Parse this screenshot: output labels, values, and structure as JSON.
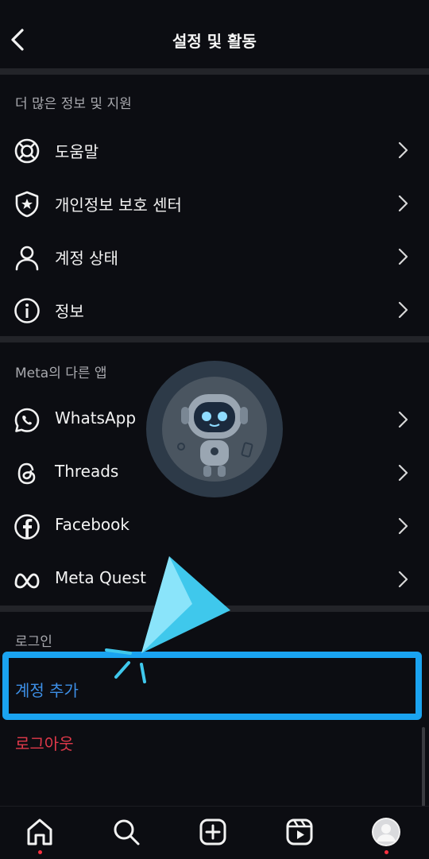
{
  "header": {
    "title": "설정 및 활동"
  },
  "sections": {
    "more_info": {
      "label": "더 많은 정보 및 지원",
      "items": [
        {
          "label": "도움말",
          "icon": "lifebuoy-icon"
        },
        {
          "label": "개인정보 보호 센터",
          "icon": "shield-star-icon"
        },
        {
          "label": "계정 상태",
          "icon": "person-icon"
        },
        {
          "label": "정보",
          "icon": "info-icon"
        }
      ]
    },
    "meta_apps": {
      "label": "Meta의 다른 앱",
      "items": [
        {
          "label": "WhatsApp",
          "icon": "whatsapp-icon"
        },
        {
          "label": "Threads",
          "icon": "threads-icon"
        },
        {
          "label": "Facebook",
          "icon": "facebook-icon"
        },
        {
          "label": "Meta Quest",
          "icon": "meta-infinity-icon"
        }
      ]
    },
    "login": {
      "label": "로그인",
      "add_account": "계정 추가",
      "logout": "로그아웃"
    }
  },
  "colors": {
    "background": "#0c0d12",
    "divider": "#232429",
    "link_blue": "#3d8fe6",
    "logout_red": "#e0394a",
    "highlight": "#1aa3f0",
    "notification_dot": "#ff3040"
  },
  "tabbar": {
    "tabs": [
      {
        "icon": "home-icon"
      },
      {
        "icon": "search-icon"
      },
      {
        "icon": "create-plus-icon"
      },
      {
        "icon": "reels-icon"
      },
      {
        "icon": "profile-avatar-icon"
      }
    ]
  }
}
